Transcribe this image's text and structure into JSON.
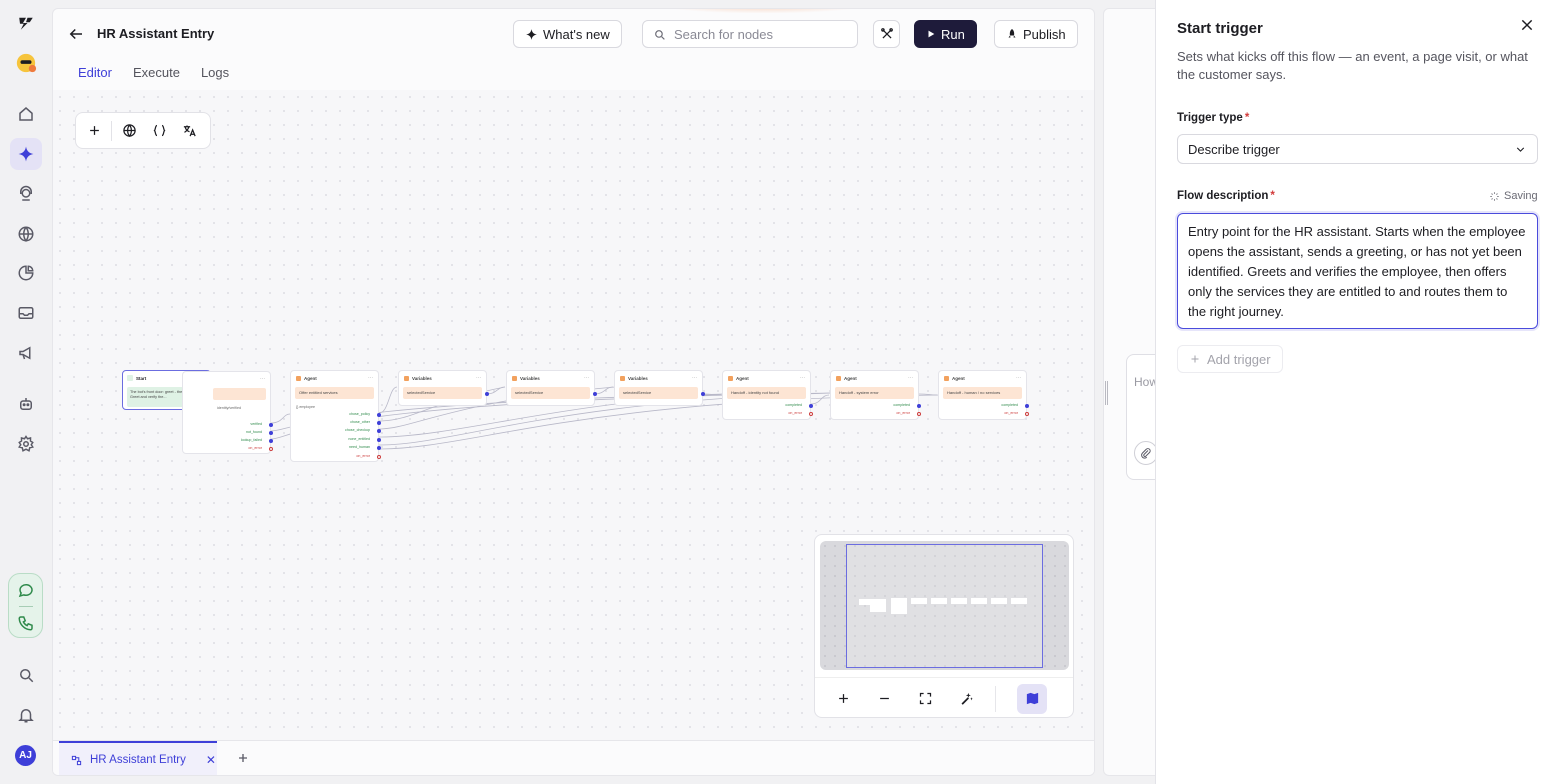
{
  "header": {
    "title": "HR Assistant Entry",
    "whats_new": "What's new",
    "search_placeholder": "Search for nodes",
    "run": "Run",
    "publish": "Publish"
  },
  "tabs": [
    {
      "label": "Editor",
      "active": true
    },
    {
      "label": "Execute",
      "active": false
    },
    {
      "label": "Logs",
      "active": false
    }
  ],
  "rail": {
    "avatar_initials": "AJ",
    "icons": [
      "logo-icon",
      "mascot-icon",
      "home-icon",
      "sparkle-icon",
      "support-agent-icon",
      "globe-icon",
      "analytics-icon",
      "inbox-icon",
      "megaphone-icon",
      "bot-icon",
      "settings-icon",
      "chat-icon",
      "phone-icon",
      "search-icon",
      "bell-icon"
    ]
  },
  "toolbar": {
    "icons": [
      "add-icon",
      "globe-icon",
      "braces-icon",
      "translate-icon"
    ]
  },
  "nodes": {
    "start": {
      "title": "Start",
      "body": "The bot's front door: greet - then - fan out. Greet and verify the..."
    },
    "n1": {
      "title": "",
      "body": "",
      "outputs": [
        "verified",
        "not_found",
        "lookup_failed",
        "on_error"
      ],
      "detail": "identity/verified"
    },
    "n2": {
      "title": "Agent",
      "body": "Offer entitled services",
      "detail": "{} employee",
      "outputs": [
        "chose_policy",
        "chose_other",
        "chose_checkup",
        "none_entitled",
        "need_human",
        "on_error"
      ]
    },
    "n3": {
      "title": "Variables",
      "body": "selectedService"
    },
    "n4": {
      "title": "Variables",
      "body": "selectedService"
    },
    "n5": {
      "title": "Variables",
      "body": "selectedService"
    },
    "n6": {
      "title": "Agent",
      "body": "Handoff - identity not found",
      "outputs": [
        "completed",
        "on_error"
      ]
    },
    "n7": {
      "title": "Agent",
      "body": "Handoff - system error",
      "outputs": [
        "completed",
        "on_error"
      ]
    },
    "n8": {
      "title": "Agent",
      "body": "Handoff - human / no services",
      "outputs": [
        "completed",
        "on_error"
      ]
    }
  },
  "bottom_tab": {
    "label": "HR Assistant Entry"
  },
  "middle": {
    "placeholder": "How"
  },
  "panel": {
    "title": "Start trigger",
    "description": "Sets what kicks off this flow — an event, a page visit, or what the customer says.",
    "trigger_type_label": "Trigger type",
    "trigger_type_value": "Describe trigger",
    "flow_description_label": "Flow description",
    "saving": "Saving",
    "flow_description_value": "Entry point for the HR assistant. Starts when the employee opens the assistant, sends a greeting, or has not yet been identified. Greets and verifies the employee, then offers only the services they are entitled to and routes them to the right journey.",
    "add_trigger": "Add trigger",
    "required_marker": "*"
  },
  "colors": {
    "accent": "#3e3fd8",
    "dark_button": "#1e1b3a",
    "required": "#d23b3b"
  }
}
